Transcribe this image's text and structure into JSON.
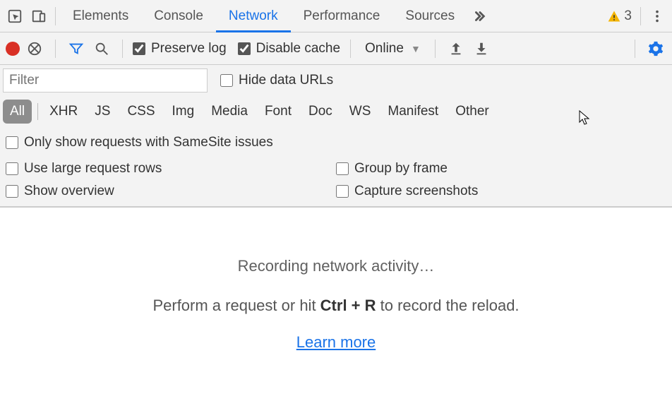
{
  "tabs": {
    "elements": "Elements",
    "console": "Console",
    "network": "Network",
    "performance": "Performance",
    "sources": "Sources"
  },
  "warnings_count": "3",
  "toolbar": {
    "preserve_log": "Preserve log",
    "disable_cache": "Disable cache",
    "throttling": "Online"
  },
  "filter": {
    "placeholder": "Filter",
    "hide_data_urls": "Hide data URLs"
  },
  "types": {
    "all": "All",
    "xhr": "XHR",
    "js": "JS",
    "css": "CSS",
    "img": "Img",
    "media": "Media",
    "font": "Font",
    "doc": "Doc",
    "ws": "WS",
    "manifest": "Manifest",
    "other": "Other"
  },
  "samesite": "Only show requests with SameSite issues",
  "opts": {
    "large_rows": "Use large request rows",
    "group_frame": "Group by frame",
    "show_overview": "Show overview",
    "capture_ss": "Capture screenshots"
  },
  "empty": {
    "title": "Recording network activity…",
    "line2_pre": "Perform a request or hit ",
    "shortcut": "Ctrl + R",
    "line2_post": " to record the reload.",
    "learn_more": "Learn more"
  }
}
